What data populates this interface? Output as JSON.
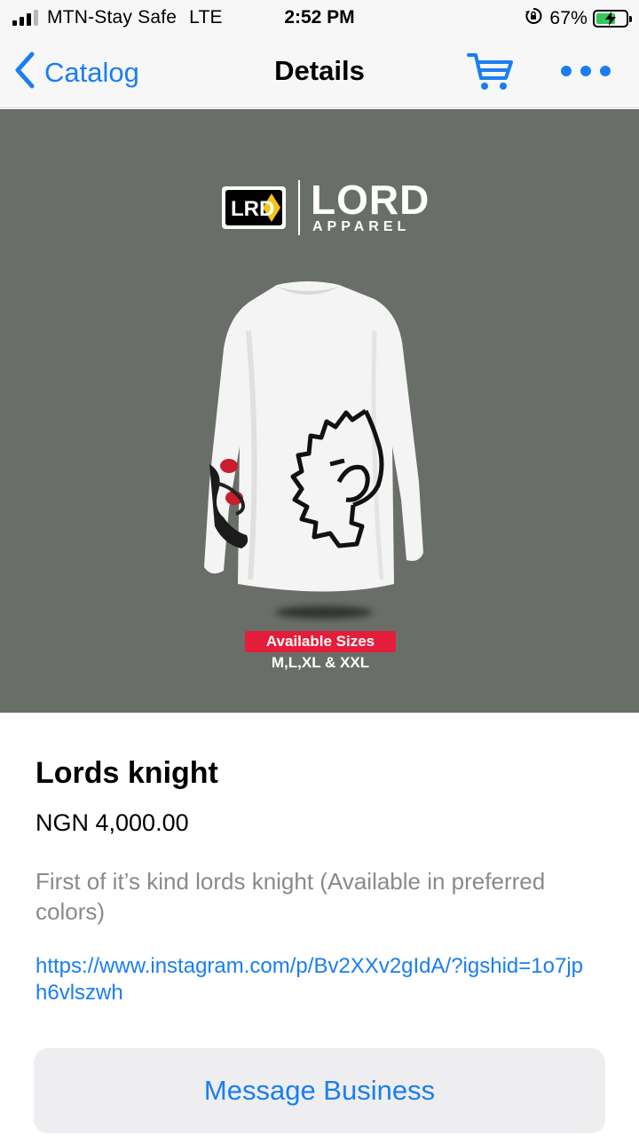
{
  "status_bar": {
    "carrier": "MTN-Stay Safe",
    "network": "LTE",
    "time": "2:52 PM",
    "battery": "67%",
    "battery_level": 0.67,
    "icons": [
      "signal-icon",
      "rotation-lock-icon",
      "battery-charging-icon"
    ]
  },
  "nav": {
    "back_label": "Catalog",
    "title": "Details",
    "icons": [
      "chevron-left-icon",
      "cart-icon",
      "more-icon"
    ],
    "accent_color": "#1a7ef2"
  },
  "product_image": {
    "brand_mark": "LRD",
    "brand_name": "LORD",
    "brand_sub": "APPAREL",
    "sizes_label": "Available Sizes",
    "sizes": "M,L,XL & XXL",
    "background_color": "#6a6e68",
    "badge_color": "#e41d3a"
  },
  "product": {
    "title": "Lords knight",
    "price": "NGN 4,000.00",
    "description": "First of it’s kind lords knight (Available in preferred colors)",
    "link": "https://www.instagram.com/p/Bv2XXv2gIdA/?igshid=1o7jph6vlszwh"
  },
  "actions": {
    "message_business": "Message Business"
  }
}
